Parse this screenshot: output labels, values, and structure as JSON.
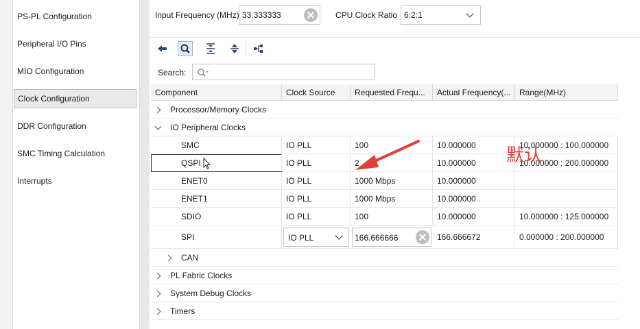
{
  "sidebar": {
    "items": [
      {
        "label": "PS-PL Configuration"
      },
      {
        "label": "Peripheral I/O Pins"
      },
      {
        "label": "MIO Configuration"
      },
      {
        "label": "Clock Configuration",
        "selected": true
      },
      {
        "label": "DDR Configuration"
      },
      {
        "label": "SMC Timing Calculation"
      },
      {
        "label": "Interrupts"
      }
    ]
  },
  "top": {
    "input_freq_label": "Input Frequency (MHz)",
    "input_freq_value": "33.333333",
    "cpu_ratio_label": "CPU Clock Ratio",
    "cpu_ratio_value": "6:2:1"
  },
  "toolbar": {
    "icons": [
      "back-arrow-icon",
      "search-icon",
      "collapse-all-icon",
      "expand-all-icon",
      "hierarchy-icon"
    ]
  },
  "search": {
    "label": "Search:",
    "value": ""
  },
  "table": {
    "columns": [
      "Component",
      "Clock Source",
      "Requested Frequ...",
      "Actual Frequency(...",
      "Range(MHz)"
    ],
    "groups": {
      "processor": "Processor/Memory Clocks",
      "io": "IO Peripheral Clocks",
      "can": "CAN",
      "pl_fabric": "PL Fabric Clocks",
      "debug": "System Debug Clocks",
      "timers": "Timers"
    },
    "rows": [
      {
        "component": "SMC",
        "source": "IO PLL",
        "requested": "100",
        "actual": "10.000000",
        "range": "10.000000 : 100.000000"
      },
      {
        "component": "QSPI",
        "source": "IO PLL",
        "requested": "2",
        "actual": "10.000000",
        "range": "10.000000 : 200.000000"
      },
      {
        "component": "ENET0",
        "source": "IO PLL",
        "requested": "1000 Mbps",
        "actual": "10.000000",
        "range": ""
      },
      {
        "component": "ENET1",
        "source": "IO PLL",
        "requested": "1000 Mbps",
        "actual": "10.000000",
        "range": ""
      },
      {
        "component": "SDIO",
        "source": "IO PLL",
        "requested": "100",
        "actual": "10.000000",
        "range": "10.000000 : 125.000000"
      },
      {
        "component": "SPI",
        "source": "IO PLL",
        "requested": "166.666666",
        "actual": "166.666672",
        "range": "0.000000 : 200.000000"
      }
    ]
  },
  "annotation": {
    "text": "默认",
    "color": "#e0403a"
  },
  "colors": {
    "selection_border": "#b8b8b8",
    "annotation": "#e0403a"
  }
}
